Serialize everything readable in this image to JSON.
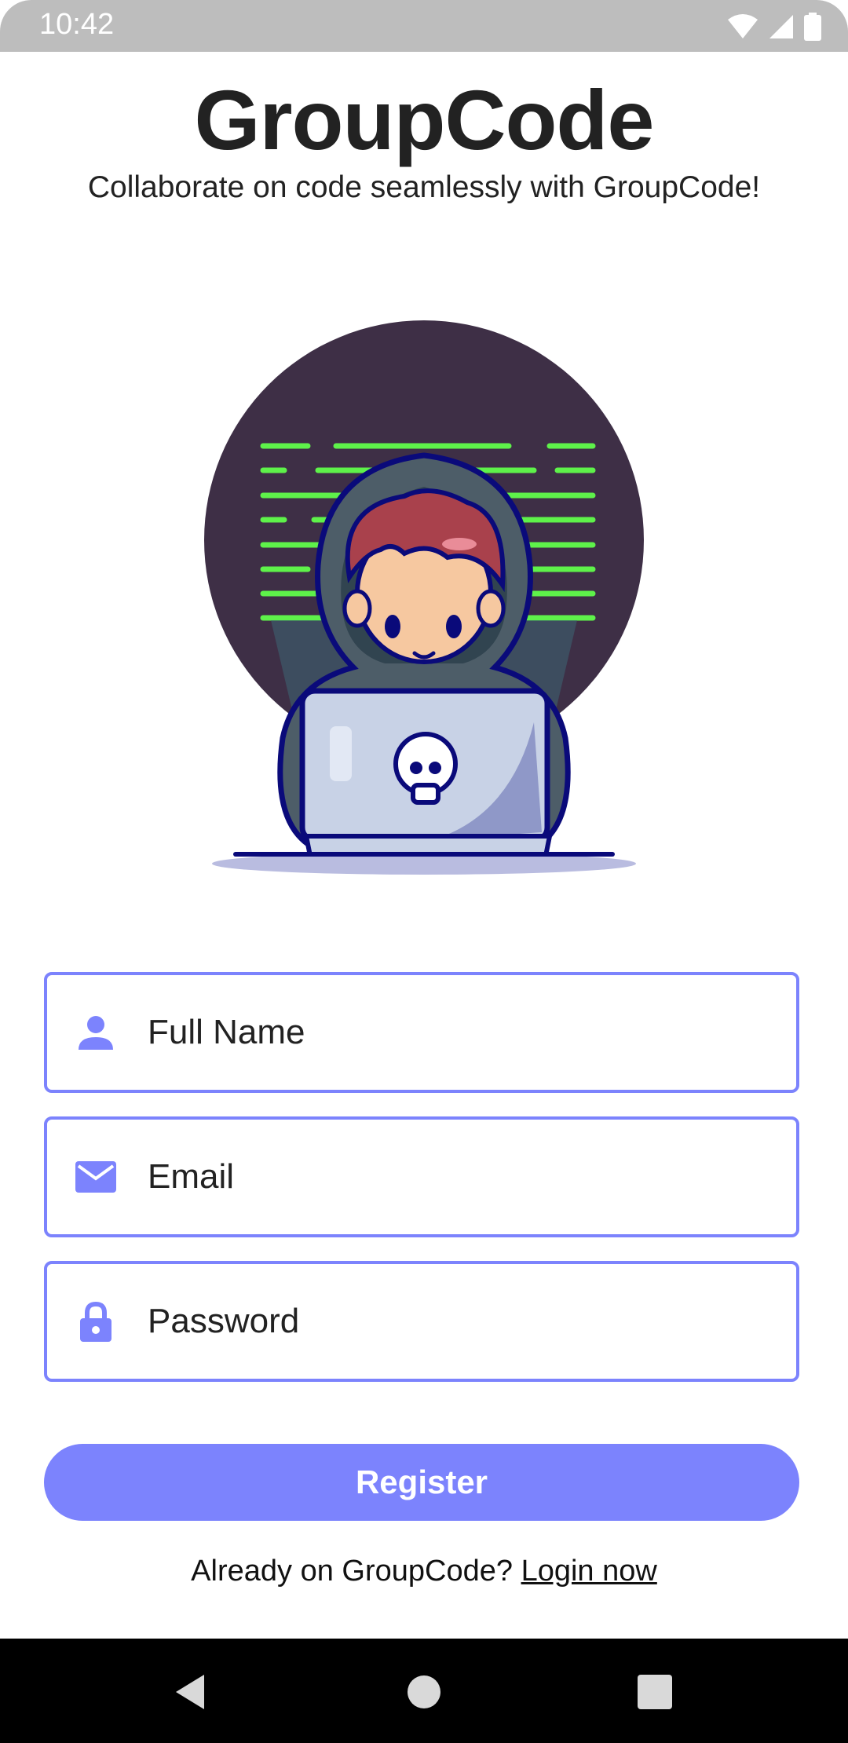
{
  "status_bar": {
    "time": "10:42",
    "icons": [
      "wifi-icon",
      "signal-icon",
      "battery-icon"
    ]
  },
  "header": {
    "title": "GroupCode",
    "subtitle": "Collaborate on code seamlessly with GroupCode!"
  },
  "form": {
    "full_name": {
      "placeholder": "Full Name",
      "value": "",
      "icon": "person-icon"
    },
    "email": {
      "placeholder": "Email",
      "value": "",
      "icon": "mail-icon"
    },
    "password": {
      "placeholder": "Password",
      "value": "",
      "icon": "lock-icon"
    },
    "register_label": "Register"
  },
  "footer": {
    "prompt": "Already on GroupCode?",
    "login_link": "Login now"
  },
  "colors": {
    "accent": "#7c83fd",
    "title": "#222222",
    "status_bar": "#bdbdbd",
    "nav_bar": "#000000",
    "illustration_circle": "#3e2f46",
    "code_lines": "#5ef24a"
  }
}
